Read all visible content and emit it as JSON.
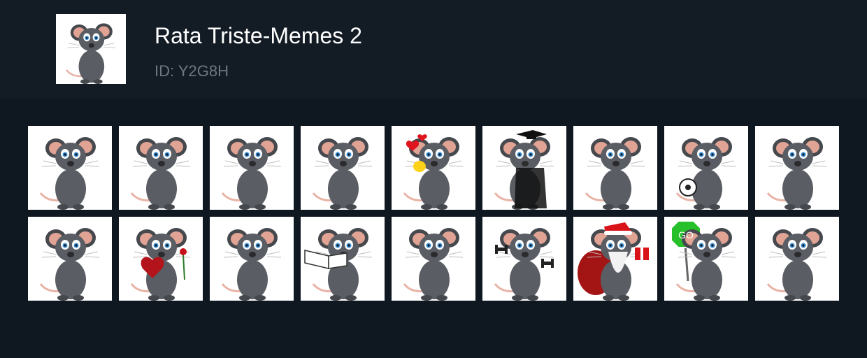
{
  "pack": {
    "title": "Rata Triste-Memes 2",
    "id_label": "ID: Y2G8H",
    "cover_icon": "mouse-cartoon-sad"
  },
  "colors": {
    "page_bg": "#0f1720",
    "header_bg": "#131b24",
    "title": "#ffffff",
    "id_text": "#6f7780",
    "tile_bg": "#ffffff"
  },
  "stickers": [
    {
      "icon": "mouse-worried-holding-tail"
    },
    {
      "icon": "mouse-face-mask"
    },
    {
      "icon": "mouse-tongue-out-waving"
    },
    {
      "icon": "mouse-trophy"
    },
    {
      "icon": "mouse-in-love-hearts",
      "accent": "heart"
    },
    {
      "icon": "mouse-graduate",
      "accent": "cap"
    },
    {
      "icon": "mouse-sad-standing"
    },
    {
      "icon": "mouse-soccer-ball",
      "accent": "ball"
    },
    {
      "icon": "mouse-microphone-singing"
    },
    {
      "icon": "mouse-shocked-hands-on-face"
    },
    {
      "icon": "mouse-heart-box-rose",
      "accent": "heartbox"
    },
    {
      "icon": "mouse-shocked-hands-on-face"
    },
    {
      "icon": "mouse-reading-book",
      "accent": "book"
    },
    {
      "icon": "mouse-hands-together"
    },
    {
      "icon": "mouse-dumbbells",
      "accent": "dumbbell"
    },
    {
      "icon": "mouse-santa-gift",
      "accent": "santa"
    },
    {
      "icon": "mouse-go-sign",
      "accent": "go",
      "sign_text": "GO"
    },
    {
      "icon": "mouse-crying"
    }
  ]
}
